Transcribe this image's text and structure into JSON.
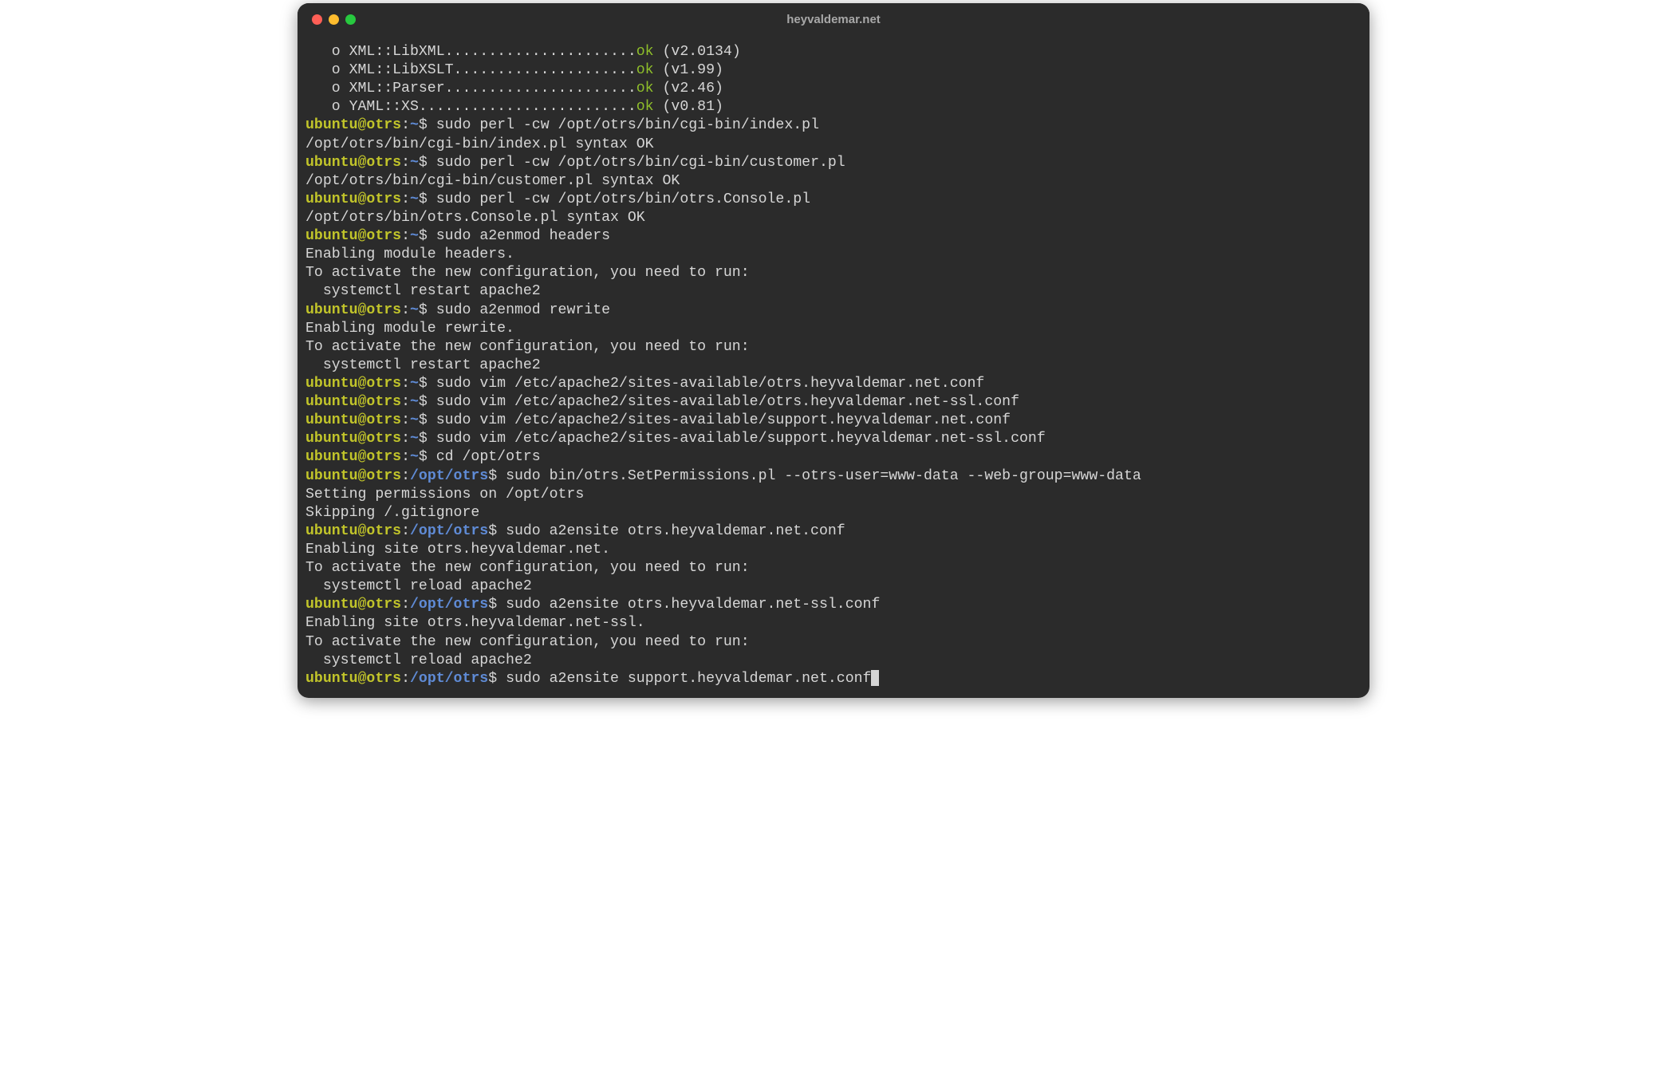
{
  "window": {
    "title": "heyvaldemar.net"
  },
  "traffic_lights": {
    "close": "close",
    "min": "minimize",
    "max": "maximize"
  },
  "colors": {
    "user": "#c1c42a",
    "path": "#5f8bd6",
    "ok": "#8fbf2a",
    "fg": "#d6d6d6",
    "bg": "#2b2b2b"
  },
  "lines": [
    {
      "type": "modcheck",
      "indent": "   ",
      "bullet": "o ",
      "name": "XML::LibXML",
      "dots": "......................",
      "status": "ok",
      "ver": " (v2.0134)"
    },
    {
      "type": "modcheck",
      "indent": "   ",
      "bullet": "o ",
      "name": "XML::LibXSLT",
      "dots": ".....................",
      "status": "ok",
      "ver": " (v1.99)"
    },
    {
      "type": "modcheck",
      "indent": "   ",
      "bullet": "o ",
      "name": "XML::Parser",
      "dots": "......................",
      "status": "ok",
      "ver": " (v2.46)"
    },
    {
      "type": "modcheck",
      "indent": "   ",
      "bullet": "o ",
      "name": "YAML::XS",
      "dots": ".........................",
      "status": "ok",
      "ver": " (v0.81)"
    },
    {
      "type": "prompt",
      "user": "ubuntu@otrs",
      "path": "~",
      "cmd": "sudo perl -cw /opt/otrs/bin/cgi-bin/index.pl"
    },
    {
      "type": "out",
      "text": "/opt/otrs/bin/cgi-bin/index.pl syntax OK"
    },
    {
      "type": "prompt",
      "user": "ubuntu@otrs",
      "path": "~",
      "cmd": "sudo perl -cw /opt/otrs/bin/cgi-bin/customer.pl"
    },
    {
      "type": "out",
      "text": "/opt/otrs/bin/cgi-bin/customer.pl syntax OK"
    },
    {
      "type": "prompt",
      "user": "ubuntu@otrs",
      "path": "~",
      "cmd": "sudo perl -cw /opt/otrs/bin/otrs.Console.pl"
    },
    {
      "type": "out",
      "text": "/opt/otrs/bin/otrs.Console.pl syntax OK"
    },
    {
      "type": "prompt",
      "user": "ubuntu@otrs",
      "path": "~",
      "cmd": "sudo a2enmod headers"
    },
    {
      "type": "out",
      "text": "Enabling module headers."
    },
    {
      "type": "out",
      "text": "To activate the new configuration, you need to run:"
    },
    {
      "type": "out",
      "text": "  systemctl restart apache2"
    },
    {
      "type": "prompt",
      "user": "ubuntu@otrs",
      "path": "~",
      "cmd": "sudo a2enmod rewrite"
    },
    {
      "type": "out",
      "text": "Enabling module rewrite."
    },
    {
      "type": "out",
      "text": "To activate the new configuration, you need to run:"
    },
    {
      "type": "out",
      "text": "  systemctl restart apache2"
    },
    {
      "type": "prompt",
      "user": "ubuntu@otrs",
      "path": "~",
      "cmd": "sudo vim /etc/apache2/sites-available/otrs.heyvaldemar.net.conf"
    },
    {
      "type": "prompt",
      "user": "ubuntu@otrs",
      "path": "~",
      "cmd": "sudo vim /etc/apache2/sites-available/otrs.heyvaldemar.net-ssl.conf"
    },
    {
      "type": "prompt",
      "user": "ubuntu@otrs",
      "path": "~",
      "cmd": "sudo vim /etc/apache2/sites-available/support.heyvaldemar.net.conf"
    },
    {
      "type": "prompt",
      "user": "ubuntu@otrs",
      "path": "~",
      "cmd": "sudo vim /etc/apache2/sites-available/support.heyvaldemar.net-ssl.conf"
    },
    {
      "type": "prompt",
      "user": "ubuntu@otrs",
      "path": "~",
      "cmd": "cd /opt/otrs"
    },
    {
      "type": "prompt",
      "user": "ubuntu@otrs",
      "path": "/opt/otrs",
      "cmd": "sudo bin/otrs.SetPermissions.pl --otrs-user=www-data --web-group=www-data"
    },
    {
      "type": "out",
      "text": "Setting permissions on /opt/otrs"
    },
    {
      "type": "out",
      "text": "Skipping /.gitignore"
    },
    {
      "type": "prompt",
      "user": "ubuntu@otrs",
      "path": "/opt/otrs",
      "cmd": "sudo a2ensite otrs.heyvaldemar.net.conf"
    },
    {
      "type": "out",
      "text": "Enabling site otrs.heyvaldemar.net."
    },
    {
      "type": "out",
      "text": "To activate the new configuration, you need to run:"
    },
    {
      "type": "out",
      "text": "  systemctl reload apache2"
    },
    {
      "type": "prompt",
      "user": "ubuntu@otrs",
      "path": "/opt/otrs",
      "cmd": "sudo a2ensite otrs.heyvaldemar.net-ssl.conf"
    },
    {
      "type": "out",
      "text": "Enabling site otrs.heyvaldemar.net-ssl."
    },
    {
      "type": "out",
      "text": "To activate the new configuration, you need to run:"
    },
    {
      "type": "out",
      "text": "  systemctl reload apache2"
    },
    {
      "type": "prompt",
      "user": "ubuntu@otrs",
      "path": "/opt/otrs",
      "cmd": "sudo a2ensite support.heyvaldemar.net.conf",
      "cursor": true
    }
  ]
}
